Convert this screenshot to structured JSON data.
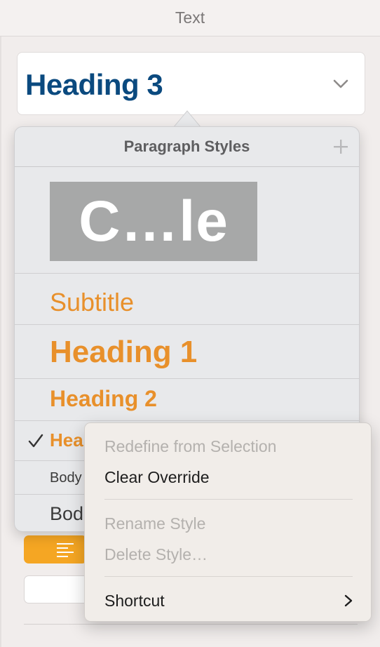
{
  "inspector": {
    "title": "Text",
    "current_style": "Heading 3"
  },
  "popover": {
    "title": "Paragraph Styles",
    "styles": [
      {
        "label": "C…le",
        "kind": "title"
      },
      {
        "label": "Subtitle",
        "kind": "subtitle"
      },
      {
        "label": "Heading 1",
        "kind": "heading1"
      },
      {
        "label": "Heading 2",
        "kind": "heading2"
      },
      {
        "label": "Hea",
        "kind": "heading3",
        "selected": true
      },
      {
        "label": "Body",
        "kind": "body-small"
      },
      {
        "label": "Bod",
        "kind": "body"
      }
    ]
  },
  "context_menu": {
    "items": [
      {
        "label": "Redefine from Selection",
        "enabled": false
      },
      {
        "label": "Clear Override",
        "enabled": true
      },
      {
        "label": "Rename Style",
        "enabled": false
      },
      {
        "label": "Delete Style…",
        "enabled": false
      },
      {
        "label": "Shortcut",
        "enabled": true,
        "submenu": true
      }
    ]
  },
  "colors": {
    "heading_accent": "#e8902b",
    "current_style_text": "#0b4a7f",
    "alignment_active": "#f5a623"
  },
  "icons": {
    "chevron": "chevron-down-icon",
    "add": "plus-icon",
    "check": "checkmark-icon",
    "align": "align-left-icon",
    "submenu": "chevron-right-icon"
  }
}
